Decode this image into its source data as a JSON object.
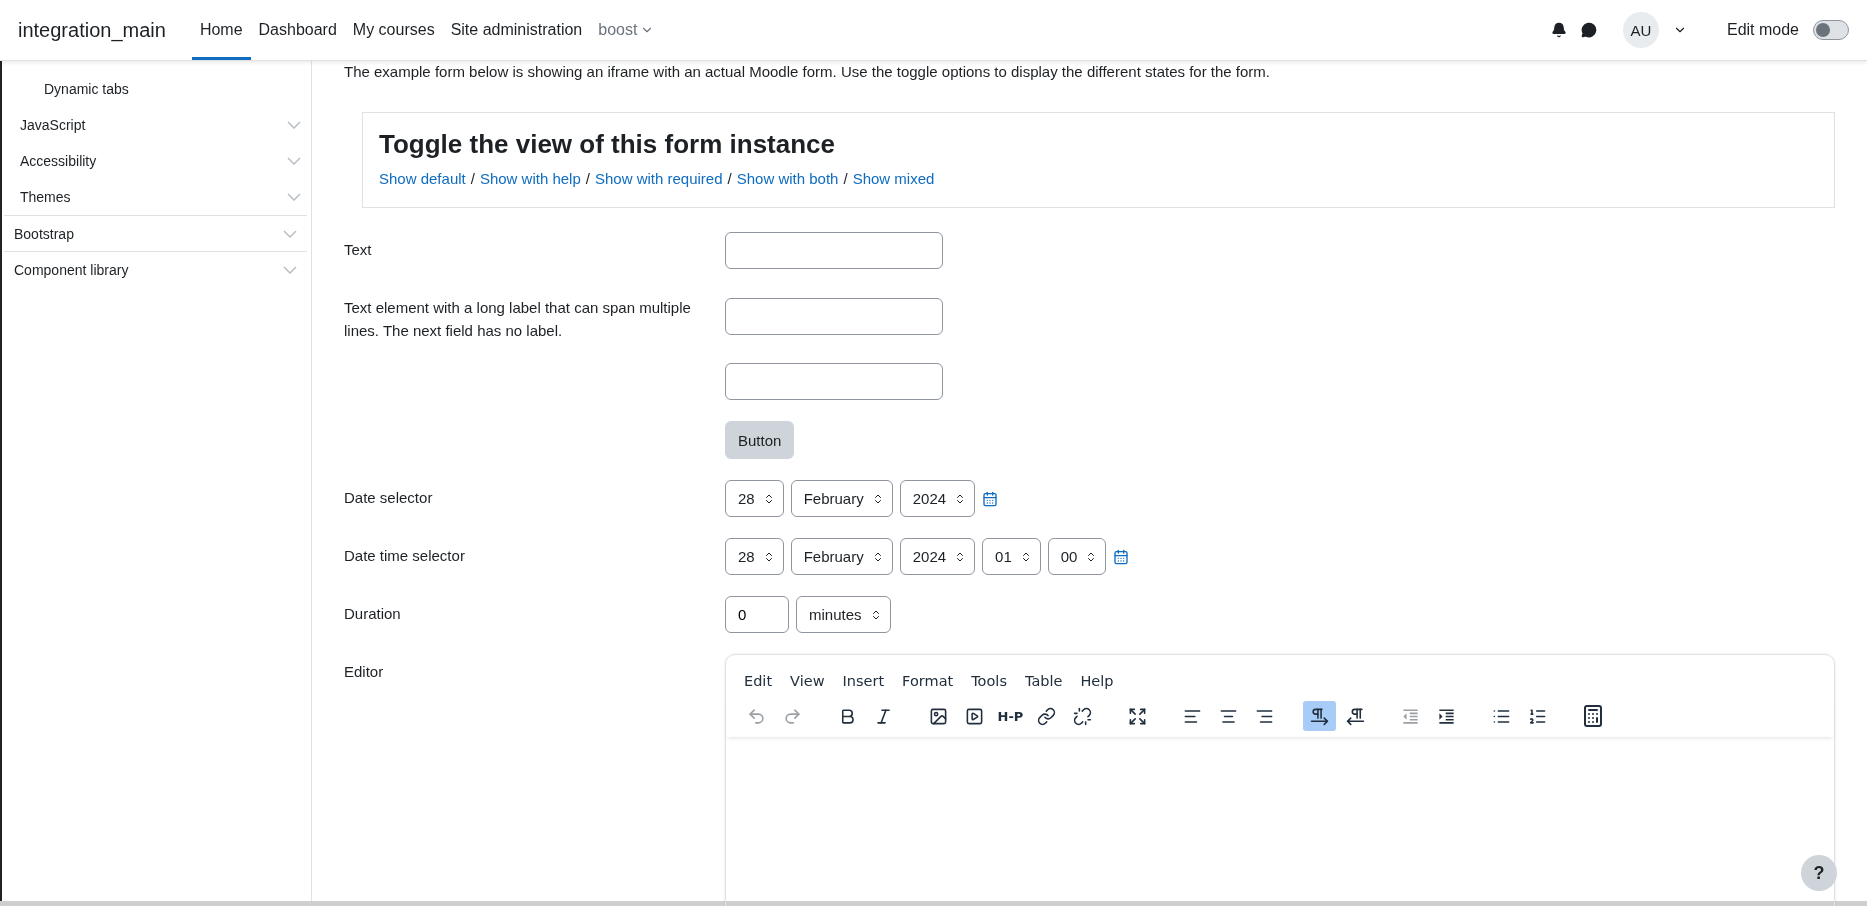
{
  "header": {
    "site_name": "integration_main",
    "nav": [
      {
        "label": "Home",
        "selected": true,
        "dropdown": false
      },
      {
        "label": "Dashboard",
        "selected": false,
        "dropdown": false
      },
      {
        "label": "My courses",
        "selected": false,
        "dropdown": false
      },
      {
        "label": "Site administration",
        "selected": false,
        "dropdown": false
      },
      {
        "label": "boost",
        "selected": false,
        "dropdown": true
      }
    ],
    "avatar": "AU",
    "edit_mode": {
      "label": "Edit mode",
      "on": false
    }
  },
  "sidebar": {
    "items": [
      {
        "children": [
          {
            "children": [
              {
                "label": "Dynamic tabs"
              }
            ]
          },
          {
            "label": "JavaScript",
            "expanded": false
          },
          {
            "label": "Accessibility",
            "expanded": false
          },
          {
            "label": "Themes",
            "expanded": false
          }
        ]
      },
      {
        "label": "Bootstrap",
        "expanded": false
      },
      {
        "label": "Component library",
        "expanded": false
      }
    ]
  },
  "intro": "The example form below is showing an iframe with an actual Moodle form. Use the toggle options to display the different states for the form.",
  "toggle_box": {
    "title": "Toggle the view of this form instance",
    "links": [
      "Show default",
      "Show with help",
      "Show with required",
      "Show with both",
      "Show mixed"
    ],
    "separator": "/"
  },
  "form": {
    "rows": [
      {
        "kind": "text",
        "label": "Text"
      },
      {
        "kind": "text",
        "label": "Text element with a long label that can span multiple lines. The next field has no label."
      },
      {
        "kind": "text"
      },
      {
        "kind": "button",
        "button": "Button"
      },
      {
        "kind": "date",
        "label": "Date selector",
        "selects": [
          "28",
          "February",
          "2024"
        ]
      },
      {
        "kind": "date",
        "label": "Date time selector",
        "selects": [
          "28",
          "February",
          "2024",
          "01",
          "00"
        ]
      },
      {
        "kind": "duration",
        "label": "Duration",
        "value": "0",
        "selects": [
          "minutes"
        ]
      },
      {
        "kind": "editor",
        "label": "Editor"
      }
    ]
  },
  "editor": {
    "menu": [
      "Edit",
      "View",
      "Insert",
      "Format",
      "Tools",
      "Table",
      "Help"
    ],
    "toolbar": [
      [
        {
          "kind": "icon",
          "disabled": true,
          "active": false
        },
        {
          "kind": "icon",
          "disabled": true,
          "active": false
        }
      ],
      [
        {
          "kind": "icon",
          "disabled": false,
          "active": false
        },
        {
          "kind": "icon",
          "disabled": false,
          "active": false
        }
      ],
      [
        {
          "kind": "icon",
          "disabled": false,
          "active": false
        },
        {
          "kind": "icon",
          "disabled": false,
          "active": false
        },
        {
          "kind": "text",
          "label": "H-P",
          "disabled": false,
          "active": false
        },
        {
          "kind": "icon",
          "disabled": false,
          "active": false
        },
        {
          "kind": "icon",
          "disabled": false,
          "active": false
        }
      ],
      [
        {
          "kind": "icon",
          "disabled": false,
          "active": false
        }
      ],
      [
        {
          "kind": "icon",
          "disabled": false,
          "active": false
        },
        {
          "kind": "icon",
          "disabled": false,
          "active": false
        },
        {
          "kind": "icon",
          "disabled": false,
          "active": false
        }
      ],
      [
        {
          "kind": "icon",
          "disabled": false,
          "active": true
        },
        {
          "kind": "icon",
          "disabled": false,
          "active": false
        }
      ],
      [
        {
          "kind": "icon",
          "disabled": true,
          "active": false
        },
        {
          "kind": "icon",
          "disabled": false,
          "active": false
        }
      ],
      [
        {
          "kind": "icon",
          "disabled": false,
          "active": false
        },
        {
          "kind": "icon",
          "disabled": false,
          "active": false
        }
      ],
      [
        {
          "kind": "icon",
          "disabled": false,
          "active": false
        }
      ]
    ]
  },
  "help_button": "?"
}
